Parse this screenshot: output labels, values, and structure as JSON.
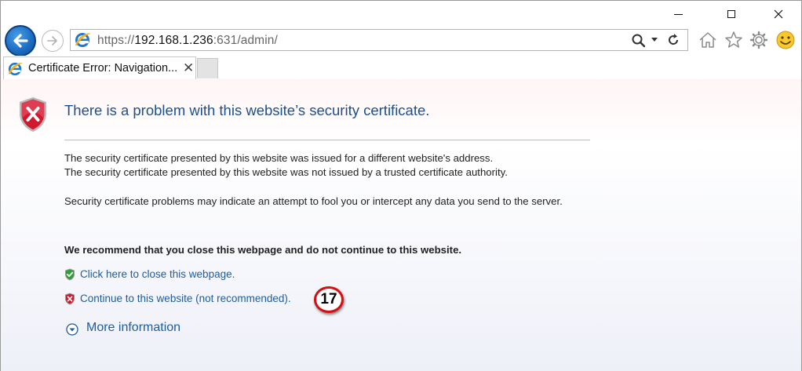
{
  "address_bar": {
    "scheme": "https://",
    "host": "192.168.1.236",
    "rest": ":631/admin/"
  },
  "tab": {
    "title": "Certificate Error: Navigation...",
    "close_glyph": "✕"
  },
  "page": {
    "heading": "There is a problem with this website’s security certificate.",
    "paragraph1_line1": "The security certificate presented by this website was issued for a different website's address.",
    "paragraph1_line2": "The security certificate presented by this website was not issued by a trusted certificate authority.",
    "paragraph2": "Security certificate problems may indicate an attempt to fool you or intercept any data you send to the server.",
    "recommendation": "We recommend that you close this webpage and do not continue to this website.",
    "close_link": "Click here to close this webpage.",
    "continue_link": "Continue to this website (not recommended).",
    "more_info": "More information"
  },
  "annotation": {
    "step_number": "17"
  },
  "icons": {
    "back": "back-arrow-icon",
    "forward": "forward-arrow-icon",
    "site": "ie-logo-icon",
    "search": "search-icon",
    "refresh": "refresh-icon",
    "home": "home-icon",
    "favorites": "star-icon",
    "tools": "gear-icon",
    "feedback": "smiley-icon",
    "error_shield": "error-shield-icon",
    "safe_shield": "green-shield-icon",
    "unsafe_shield": "red-shield-icon",
    "expand": "expand-chevron-icon"
  },
  "colors": {
    "heading": "#1d4f8c",
    "link": "#1d5c9e",
    "error_red": "#c8102e",
    "badge_ring": "#d61010"
  }
}
